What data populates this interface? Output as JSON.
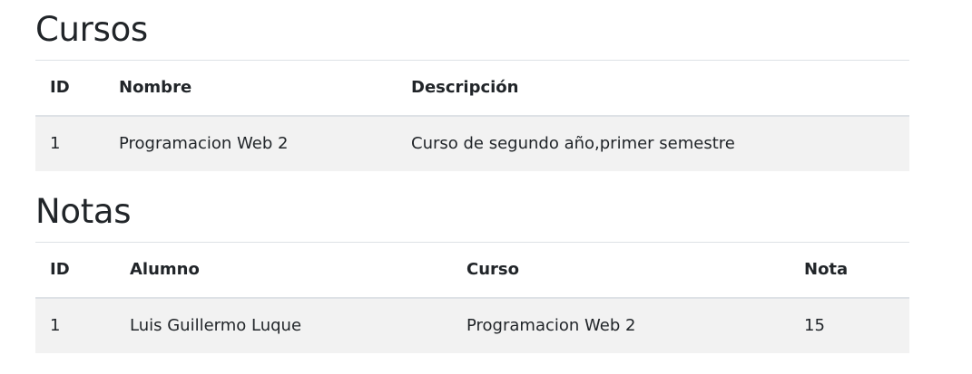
{
  "cursos": {
    "title": "Cursos",
    "headers": [
      "ID",
      "Nombre",
      "Descripción"
    ],
    "rows": [
      [
        "1",
        "Programacion Web 2",
        "Curso de segundo año,primer semestre"
      ]
    ]
  },
  "notas": {
    "title": "Notas",
    "headers": [
      "ID",
      "Alumno",
      "Curso",
      "Nota"
    ],
    "rows": [
      [
        "1",
        "Luis Guillermo Luque",
        "Programacion Web 2",
        "15"
      ]
    ]
  }
}
